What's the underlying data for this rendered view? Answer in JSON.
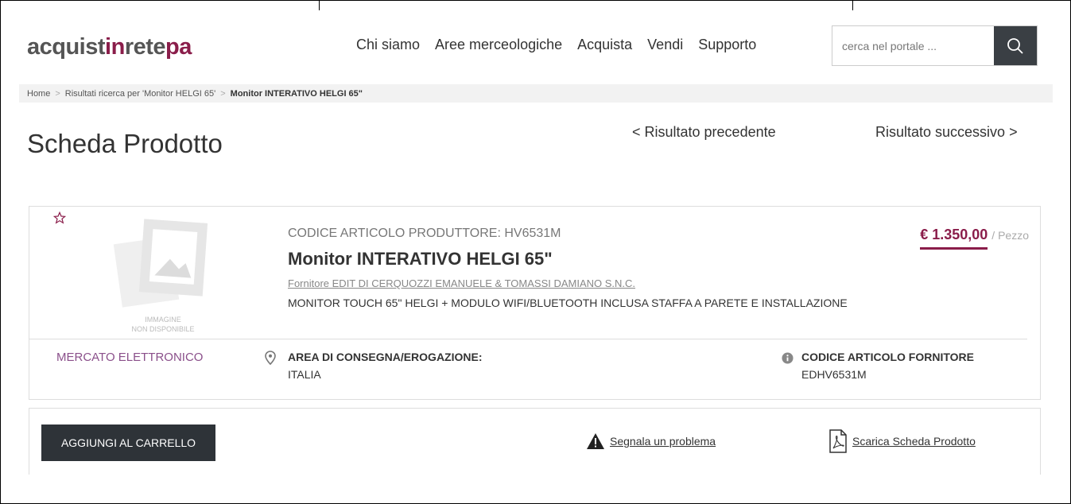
{
  "logo": {
    "part1": "acquist",
    "part2": "in",
    "part3": "rete",
    "part4": "pa"
  },
  "nav": [
    "Chi siamo",
    "Aree merceologiche",
    "Acquista",
    "Vendi",
    "Supporto"
  ],
  "search": {
    "placeholder": "cerca nel portale ...",
    "icon": "search-icon"
  },
  "breadcrumb": {
    "home": "Home",
    "results": "Risultati ricerca per 'Monitor HELGI 65'",
    "current": "Monitor INTERATIVO HELGI 65\""
  },
  "page": {
    "title": "Scheda Prodotto",
    "prev": "< Risultato precedente",
    "next": "Risultato successivo >"
  },
  "product": {
    "image_placeholder_line1": "IMMAGINE",
    "image_placeholder_line2": "NON DISPONIBILE",
    "codice": "CODICE ARTICOLO PRODUTTORE: HV6531M",
    "name": "Monitor INTERATIVO HELGI 65\"",
    "supplier": "Fornitore EDIT DI CERQUOZZI EMANUELE & TOMASSI DAMIANO S.N.C.",
    "description": "MONITOR TOUCH 65\" HELGI + MODULO WIFI/BLUETOOTH INCLUSA STAFFA A PARETE E INSTALLAZIONE",
    "price": "€ 1.350,00",
    "unit": "/ Pezzo",
    "mercato": "MERCATO ELETTRONICO",
    "area_title": "AREA DI CONSEGNA/EROGAZIONE:",
    "area_value": "ITALIA",
    "codice_fornitore_title": "CODICE ARTICOLO FORNITORE",
    "codice_fornitore_value": "EDHV6531M"
  },
  "actions": {
    "cart": "AGGIUNGI AL CARRELLO",
    "report": "Segnala un problema",
    "download": "Scarica Scheda Prodotto"
  },
  "colors": {
    "brand": "#8a1d4a",
    "dark": "#2e3338",
    "mercato": "#8a4f8a"
  }
}
